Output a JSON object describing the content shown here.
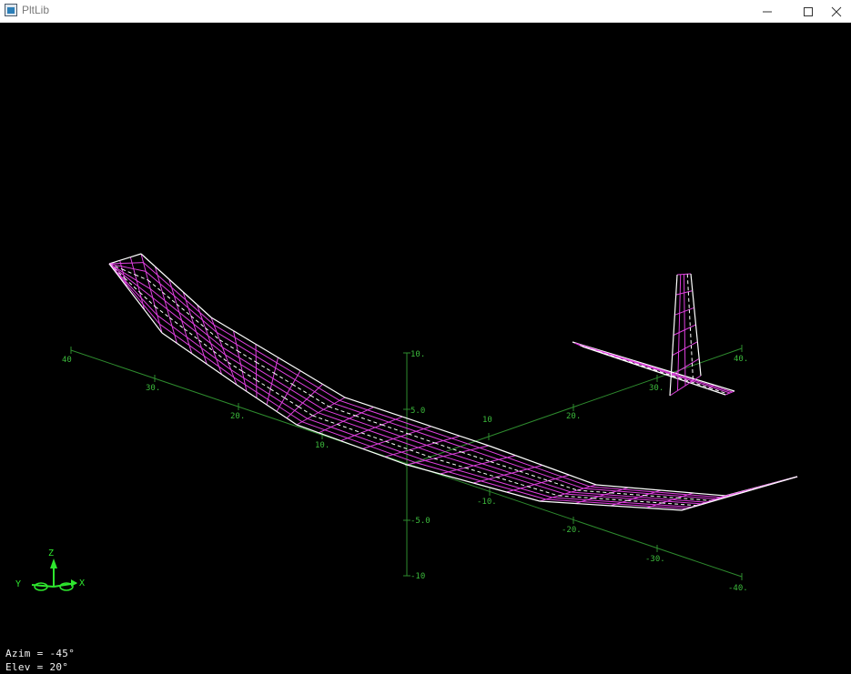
{
  "window": {
    "title": "PltLib"
  },
  "controls": {
    "minimize": "minimize",
    "maximize": "maximize",
    "close": "close"
  },
  "axes": {
    "x_ticks": [
      "40",
      "30.",
      "20.",
      "10.",
      "-10.",
      "-20.",
      "-30.",
      "-40."
    ],
    "y_ticks": [
      "10",
      "20.",
      "30.",
      "40."
    ],
    "z_ticks": [
      "10.",
      "5.0",
      "-5.0",
      "-10"
    ]
  },
  "triad": {
    "z": "Z",
    "y": "Y",
    "x": "X"
  },
  "status": {
    "azimuth": "Azim = -45°",
    "elevation": "Elev = 20°"
  },
  "colors": {
    "axis": "#2e8b2e",
    "wire": "#e040e0",
    "edge": "#ffffff"
  }
}
